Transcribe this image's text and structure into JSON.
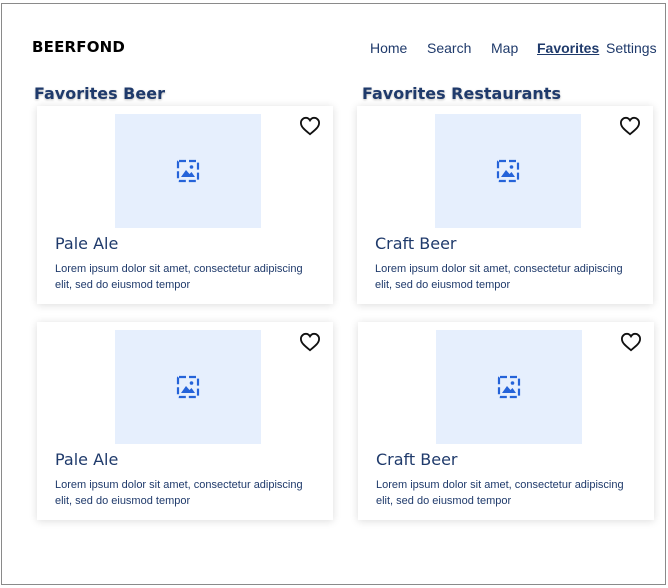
{
  "app": {
    "brand": "BEERFOND"
  },
  "nav": {
    "home": "Home",
    "search": "Search",
    "map": "Map",
    "favorites": "Favorites",
    "settings": "Settings"
  },
  "sections": {
    "beer_title": "Favorites Beer",
    "restaurants_title": "Favorites Restaurants"
  },
  "cards": [
    {
      "title": "Pale Ale",
      "description": "Lorem ipsum dolor sit amet, consectetur adipiscing elit, sed do eiusmod tempor"
    },
    {
      "title": "Craft Beer",
      "description": "Lorem ipsum dolor sit amet, consectetur adipiscing elit, sed do eiusmod tempor"
    },
    {
      "title": "Pale Ale",
      "description": "Lorem ipsum dolor sit amet, consectetur adipiscing elit, sed do eiusmod tempor"
    },
    {
      "title": "Craft Beer",
      "description": "Lorem ipsum dolor sit amet, consectetur adipiscing elit, sed do eiusmod tempor"
    }
  ],
  "icons": {
    "favorite": "heart-outline-icon",
    "placeholder": "image-placeholder-icon"
  },
  "colors": {
    "text": "#1f3a6b",
    "placeholder_bg": "#e6effd",
    "icon_accent": "#2563d9"
  }
}
